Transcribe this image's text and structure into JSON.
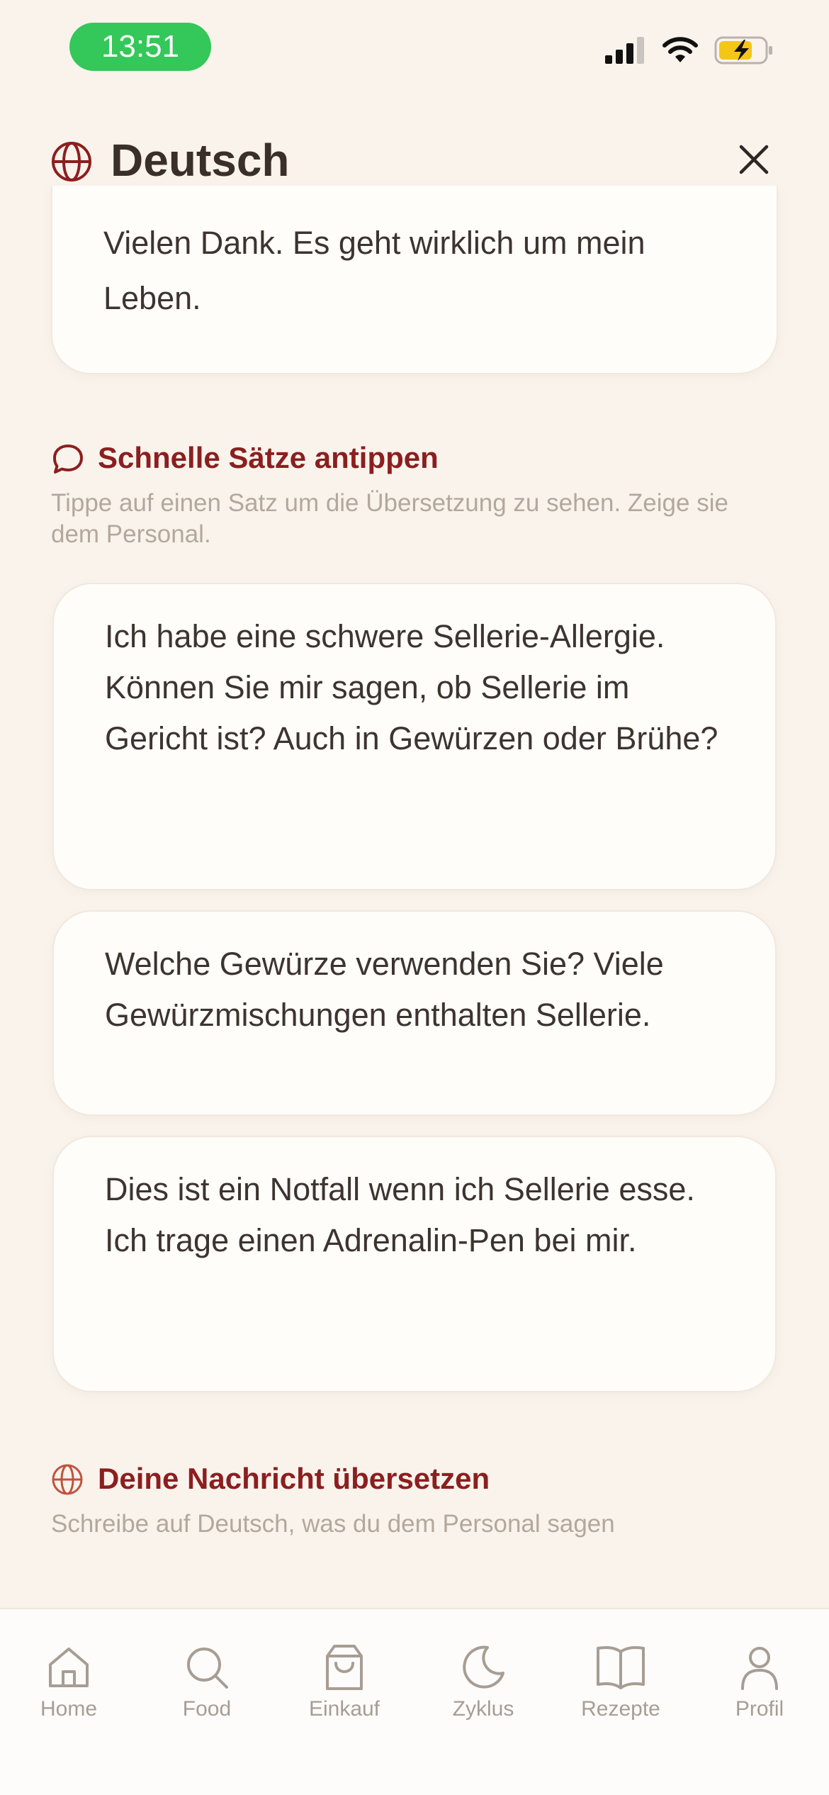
{
  "status": {
    "time": "13:51",
    "icons": [
      "cellular-signal-icon",
      "wifi-icon",
      "battery-charging-icon"
    ]
  },
  "header": {
    "title": "Deutsch",
    "icons": {
      "leading": "globe-icon",
      "close": "close-icon"
    }
  },
  "previous_card": {
    "text": "Vielen Dank. Es geht wirklich um mein Leben."
  },
  "quick_phrases": {
    "title": "Schnelle Sätze antippen",
    "subtitle": "Tippe auf einen Satz um die Übersetzung zu sehen. Zeige sie dem Personal.",
    "icon": "speech-bubble-icon",
    "items": [
      {
        "text": "Ich habe eine schwere Sellerie-Allergie. Können Sie mir sagen, ob Sellerie im Gericht ist? Auch in Gewürzen oder Brühe?"
      },
      {
        "text": "Welche Gewürze verwenden Sie? Viele Gewürzmischungen enthalten Sellerie."
      },
      {
        "text": "Dies ist ein Notfall wenn ich Sellerie esse. Ich trage einen Adrenalin-Pen bei mir."
      }
    ]
  },
  "translate_section": {
    "title": "Deine Nachricht übersetzen",
    "subtitle": "Schreibe auf Deutsch, was du dem Personal sagen",
    "icon": "globe-icon"
  },
  "tabbar": {
    "items": [
      {
        "label": "Home",
        "icon": "home-icon"
      },
      {
        "label": "Food",
        "icon": "search-icon"
      },
      {
        "label": "Einkauf",
        "icon": "shopping-bag-icon"
      },
      {
        "label": "Zyklus",
        "icon": "moon-icon"
      },
      {
        "label": "Rezepte",
        "icon": "book-icon"
      },
      {
        "label": "Profil",
        "icon": "person-icon"
      }
    ]
  },
  "colors": {
    "background": "#f9f3ec",
    "card": "#fffdfa",
    "accent": "#8b1f1f",
    "time_pill": "#34c759",
    "muted_text": "#b3a89e",
    "tab_inactive": "#a79d94"
  }
}
